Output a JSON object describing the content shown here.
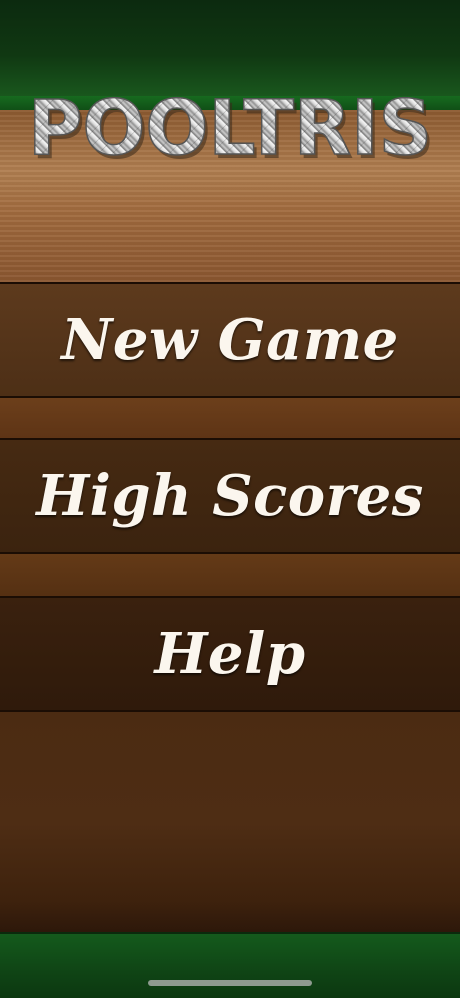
{
  "app": {
    "title": "POOLTRIS"
  },
  "menu": {
    "new_game_label": "New Game",
    "high_scores_label": "High Scores",
    "help_label": "Help"
  },
  "colors": {
    "felt_green": "#103812",
    "wood_light": "#b07e50",
    "wood_dark": "#3a210e",
    "label_text": "#fbf6ee"
  }
}
